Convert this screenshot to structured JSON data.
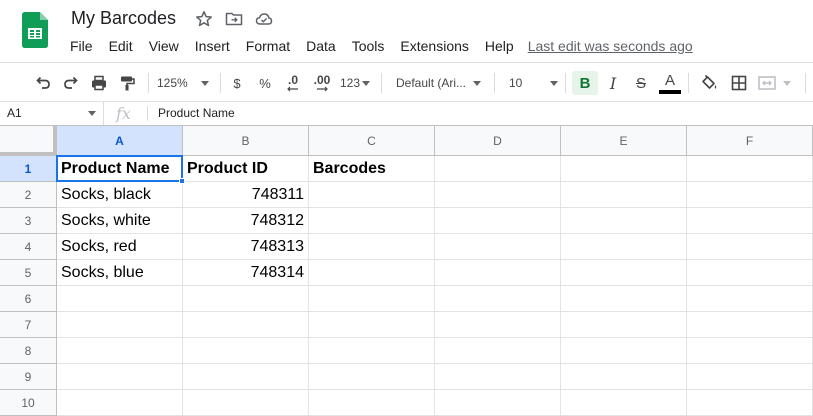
{
  "app": {
    "doc_title": "My Barcodes",
    "last_edit": "Last edit was seconds ago",
    "menu": [
      "File",
      "Edit",
      "View",
      "Insert",
      "Format",
      "Data",
      "Tools",
      "Extensions",
      "Help"
    ],
    "logo_color": "#0f9d58"
  },
  "toolbar": {
    "zoom": "125%",
    "currency": "$",
    "percent": "%",
    "decrease_decimal": ".0",
    "increase_decimal": ".00",
    "more_formats": "123",
    "font": "Default (Ari...",
    "font_size": "10",
    "bold": "B",
    "italic": "I",
    "strikethrough": "S",
    "text_color_letter": "A",
    "icons": [
      "undo-icon",
      "redo-icon",
      "print-icon",
      "paint-format-icon",
      "fill-color-icon",
      "borders-icon",
      "merge-cells-icon"
    ]
  },
  "formula_bar": {
    "cell_ref": "A1",
    "fx": "fx",
    "value": "Product Name"
  },
  "grid": {
    "columns": [
      "A",
      "B",
      "C",
      "D",
      "E",
      "F"
    ],
    "rows": [
      "1",
      "2",
      "3",
      "4",
      "5",
      "6",
      "7",
      "8",
      "9",
      "10"
    ],
    "selected_cell": "A1",
    "data": [
      [
        "Product Name",
        "Product ID",
        "Barcodes"
      ],
      [
        "Socks, black",
        "748311",
        ""
      ],
      [
        "Socks, white",
        "748312",
        ""
      ],
      [
        "Socks, red",
        "748313",
        ""
      ],
      [
        "Socks, blue",
        "748314",
        ""
      ]
    ],
    "selection_color": "#1a73e8"
  }
}
